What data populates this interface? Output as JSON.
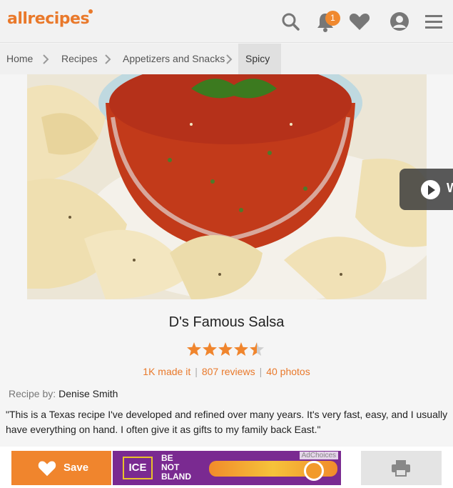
{
  "header": {
    "logo_text": "allrecipes",
    "notification_count": "1",
    "icons": [
      "search-icon",
      "bell-icon",
      "heart-icon",
      "user-icon",
      "menu-icon"
    ],
    "accent_color": "#e9792b"
  },
  "breadcrumb": {
    "items": [
      "Home",
      "Recipes",
      "Appetizers and Snacks",
      "Spicy"
    ]
  },
  "hero": {
    "video_label": "W"
  },
  "recipe": {
    "title": "D's Famous Salsa",
    "rating": 4.5,
    "made_it": "1K made it",
    "reviews": "807 reviews",
    "photos": "40 photos",
    "byline_label": "Recipe by:",
    "author": "Denise Smith",
    "description": "\"This is a Texas recipe I've developed and refined over many years. It's very fast, easy, and I usually have everything on hand. I often give it as gifts to my family back East.\""
  },
  "bottom_bar": {
    "save_label": "Save",
    "ad": {
      "adchoices": "AdChoices",
      "brand": "ICE",
      "slogan_1": "BE",
      "slogan_2": "NOT",
      "slogan_3": "BLAND"
    }
  }
}
